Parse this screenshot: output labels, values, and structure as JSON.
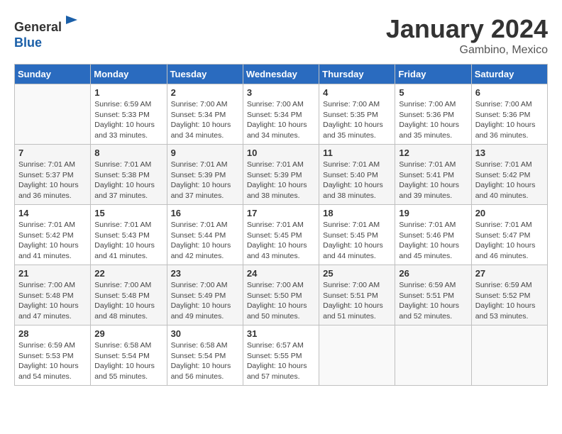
{
  "header": {
    "logo_line1": "General",
    "logo_line2": "Blue",
    "title": "January 2024",
    "subtitle": "Gambino, Mexico"
  },
  "days_of_week": [
    "Sunday",
    "Monday",
    "Tuesday",
    "Wednesday",
    "Thursday",
    "Friday",
    "Saturday"
  ],
  "weeks": [
    [
      {
        "day": "",
        "info": ""
      },
      {
        "day": "1",
        "info": "Sunrise: 6:59 AM\nSunset: 5:33 PM\nDaylight: 10 hours\nand 33 minutes."
      },
      {
        "day": "2",
        "info": "Sunrise: 7:00 AM\nSunset: 5:34 PM\nDaylight: 10 hours\nand 34 minutes."
      },
      {
        "day": "3",
        "info": "Sunrise: 7:00 AM\nSunset: 5:34 PM\nDaylight: 10 hours\nand 34 minutes."
      },
      {
        "day": "4",
        "info": "Sunrise: 7:00 AM\nSunset: 5:35 PM\nDaylight: 10 hours\nand 35 minutes."
      },
      {
        "day": "5",
        "info": "Sunrise: 7:00 AM\nSunset: 5:36 PM\nDaylight: 10 hours\nand 35 minutes."
      },
      {
        "day": "6",
        "info": "Sunrise: 7:00 AM\nSunset: 5:36 PM\nDaylight: 10 hours\nand 36 minutes."
      }
    ],
    [
      {
        "day": "7",
        "info": "Sunrise: 7:01 AM\nSunset: 5:37 PM\nDaylight: 10 hours\nand 36 minutes."
      },
      {
        "day": "8",
        "info": "Sunrise: 7:01 AM\nSunset: 5:38 PM\nDaylight: 10 hours\nand 37 minutes."
      },
      {
        "day": "9",
        "info": "Sunrise: 7:01 AM\nSunset: 5:39 PM\nDaylight: 10 hours\nand 37 minutes."
      },
      {
        "day": "10",
        "info": "Sunrise: 7:01 AM\nSunset: 5:39 PM\nDaylight: 10 hours\nand 38 minutes."
      },
      {
        "day": "11",
        "info": "Sunrise: 7:01 AM\nSunset: 5:40 PM\nDaylight: 10 hours\nand 38 minutes."
      },
      {
        "day": "12",
        "info": "Sunrise: 7:01 AM\nSunset: 5:41 PM\nDaylight: 10 hours\nand 39 minutes."
      },
      {
        "day": "13",
        "info": "Sunrise: 7:01 AM\nSunset: 5:42 PM\nDaylight: 10 hours\nand 40 minutes."
      }
    ],
    [
      {
        "day": "14",
        "info": "Sunrise: 7:01 AM\nSunset: 5:42 PM\nDaylight: 10 hours\nand 41 minutes."
      },
      {
        "day": "15",
        "info": "Sunrise: 7:01 AM\nSunset: 5:43 PM\nDaylight: 10 hours\nand 41 minutes."
      },
      {
        "day": "16",
        "info": "Sunrise: 7:01 AM\nSunset: 5:44 PM\nDaylight: 10 hours\nand 42 minutes."
      },
      {
        "day": "17",
        "info": "Sunrise: 7:01 AM\nSunset: 5:45 PM\nDaylight: 10 hours\nand 43 minutes."
      },
      {
        "day": "18",
        "info": "Sunrise: 7:01 AM\nSunset: 5:45 PM\nDaylight: 10 hours\nand 44 minutes."
      },
      {
        "day": "19",
        "info": "Sunrise: 7:01 AM\nSunset: 5:46 PM\nDaylight: 10 hours\nand 45 minutes."
      },
      {
        "day": "20",
        "info": "Sunrise: 7:01 AM\nSunset: 5:47 PM\nDaylight: 10 hours\nand 46 minutes."
      }
    ],
    [
      {
        "day": "21",
        "info": "Sunrise: 7:00 AM\nSunset: 5:48 PM\nDaylight: 10 hours\nand 47 minutes."
      },
      {
        "day": "22",
        "info": "Sunrise: 7:00 AM\nSunset: 5:48 PM\nDaylight: 10 hours\nand 48 minutes."
      },
      {
        "day": "23",
        "info": "Sunrise: 7:00 AM\nSunset: 5:49 PM\nDaylight: 10 hours\nand 49 minutes."
      },
      {
        "day": "24",
        "info": "Sunrise: 7:00 AM\nSunset: 5:50 PM\nDaylight: 10 hours\nand 50 minutes."
      },
      {
        "day": "25",
        "info": "Sunrise: 7:00 AM\nSunset: 5:51 PM\nDaylight: 10 hours\nand 51 minutes."
      },
      {
        "day": "26",
        "info": "Sunrise: 6:59 AM\nSunset: 5:51 PM\nDaylight: 10 hours\nand 52 minutes."
      },
      {
        "day": "27",
        "info": "Sunrise: 6:59 AM\nSunset: 5:52 PM\nDaylight: 10 hours\nand 53 minutes."
      }
    ],
    [
      {
        "day": "28",
        "info": "Sunrise: 6:59 AM\nSunset: 5:53 PM\nDaylight: 10 hours\nand 54 minutes."
      },
      {
        "day": "29",
        "info": "Sunrise: 6:58 AM\nSunset: 5:54 PM\nDaylight: 10 hours\nand 55 minutes."
      },
      {
        "day": "30",
        "info": "Sunrise: 6:58 AM\nSunset: 5:54 PM\nDaylight: 10 hours\nand 56 minutes."
      },
      {
        "day": "31",
        "info": "Sunrise: 6:57 AM\nSunset: 5:55 PM\nDaylight: 10 hours\nand 57 minutes."
      },
      {
        "day": "",
        "info": ""
      },
      {
        "day": "",
        "info": ""
      },
      {
        "day": "",
        "info": ""
      }
    ]
  ]
}
